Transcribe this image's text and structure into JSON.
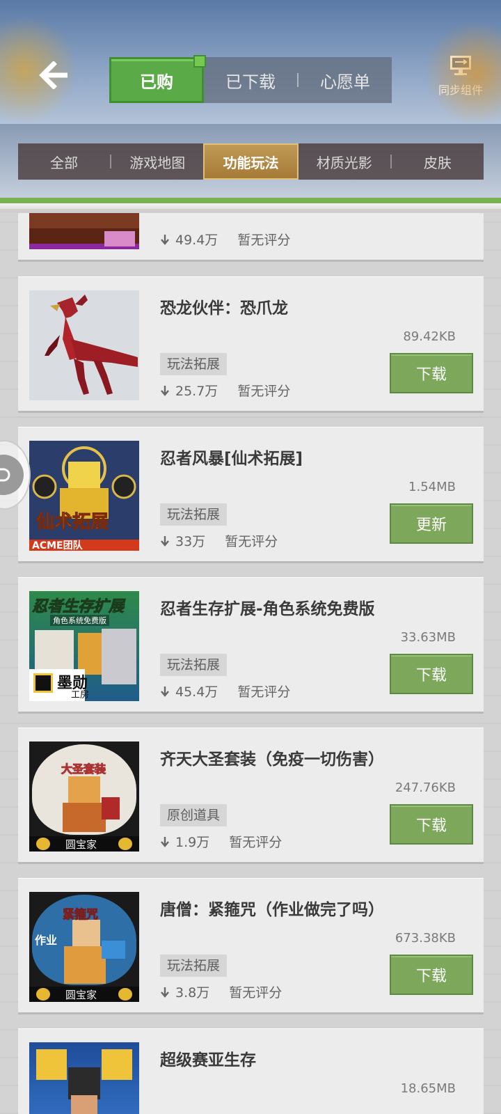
{
  "header": {
    "back_icon": "arrow-left-icon",
    "tabs": [
      {
        "label": "已购",
        "active": true
      },
      {
        "label": "已下载",
        "active": false
      },
      {
        "label": "心愿单",
        "active": false
      }
    ],
    "sync": {
      "label": "同步组件",
      "icon": "sync-component-icon"
    }
  },
  "categories": [
    {
      "label": "全部",
      "active": false
    },
    {
      "label": "游戏地图",
      "active": false
    },
    {
      "label": "功能玩法",
      "active": true
    },
    {
      "label": "材质光影",
      "active": false
    },
    {
      "label": "皮肤",
      "active": false
    }
  ],
  "items": [
    {
      "title": "",
      "downloads": "49.4万",
      "rating": "暂无评分",
      "size": "",
      "tag": "",
      "action": ""
    },
    {
      "title": "恐龙伙伴：恐爪龙",
      "size": "89.42KB",
      "tag": "玩法拓展",
      "downloads": "25.7万",
      "rating": "暂无评分",
      "action": "下载"
    },
    {
      "title": "忍者风暴[仙术拓展]",
      "size": "1.54MB",
      "tag": "玩法拓展",
      "downloads": "33万",
      "rating": "暂无评分",
      "action": "更新",
      "thumb_text": "仙术拓展",
      "thumb_sub": "ACME团队"
    },
    {
      "title": "忍者生存扩展-角色系统免费版",
      "size": "33.63MB",
      "tag": "玩法拓展",
      "downloads": "45.4万",
      "rating": "暂无评分",
      "action": "下载",
      "thumb_text": "忍者生存扩展",
      "thumb_sub": "角色系统免费版",
      "thumb_brand": "墨勋",
      "thumb_brand_sub": "工房"
    },
    {
      "title": "齐天大圣套装（免疫一切伤害）",
      "size": "247.76KB",
      "tag": "原创道具",
      "downloads": "1.9万",
      "rating": "暂无评分",
      "action": "下载",
      "thumb_text": "大圣套装",
      "thumb_brand": "圆宝家"
    },
    {
      "title": "唐僧：紧箍咒（作业做完了吗）",
      "size": "673.38KB",
      "tag": "玩法拓展",
      "downloads": "3.8万",
      "rating": "暂无评分",
      "action": "下载",
      "thumb_text": "紧箍咒",
      "thumb_sub": "作业",
      "thumb_brand": "圆宝家"
    },
    {
      "title": "超级赛亚生存",
      "size": "18.65MB"
    }
  ],
  "colors": {
    "green_accent": "#5aab47",
    "button_green": "#7da85b",
    "category_active": "#b08841"
  }
}
